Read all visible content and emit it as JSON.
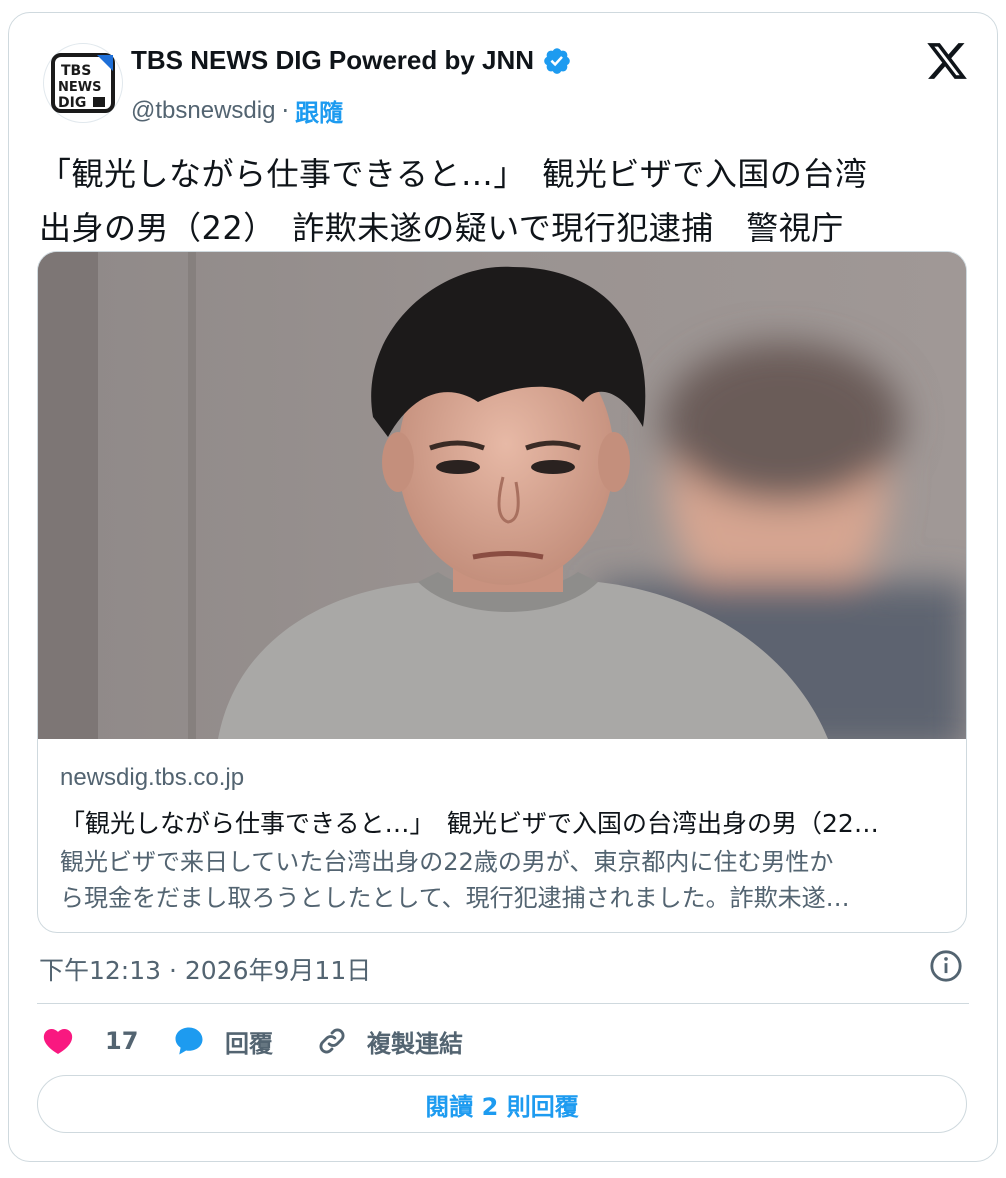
{
  "account": {
    "name": "TBS NEWS DIG Powered by JNN",
    "handle": "@tbsnewsdig",
    "separator": "·",
    "follow_label": "跟隨",
    "avatar_logo_lines": [
      "TBS",
      "NEWS",
      "DIG"
    ],
    "verified": true
  },
  "tweet": {
    "text_line1": "「観光しながら仕事できると…」　観光ビザで入国の台湾",
    "text_line2": "出身の男（22）　詐欺未遂の疑いで現行犯逮捕　警視庁"
  },
  "link_card": {
    "domain": "newsdig.tbs.co.jp",
    "title": "「観光しながら仕事できると…」　観光ビザで入国の台湾出身の男（22…",
    "description_line1": "観光ビザで来日していた台湾出身の22歳の男が、東京都内に住む男性か",
    "description_line2": "ら現金をだまし取ろうとしたとして、現行犯逮捕されました。詐欺未遂…"
  },
  "timestamp": "下午12:13 · 2026年9月11日",
  "actions": {
    "like_count": "17",
    "reply_label": "回覆",
    "copy_link_label": "複製連結"
  },
  "read_replies_label": "閱讀 2 則回覆",
  "colors": {
    "accent": "#1d9bf0",
    "like": "#f91880",
    "muted_text": "#536471",
    "border": "#cfd9de"
  },
  "icons": [
    "verified-badge-icon",
    "x-logo-icon",
    "info-icon",
    "heart-icon",
    "reply-bubble-icon",
    "link-icon"
  ]
}
